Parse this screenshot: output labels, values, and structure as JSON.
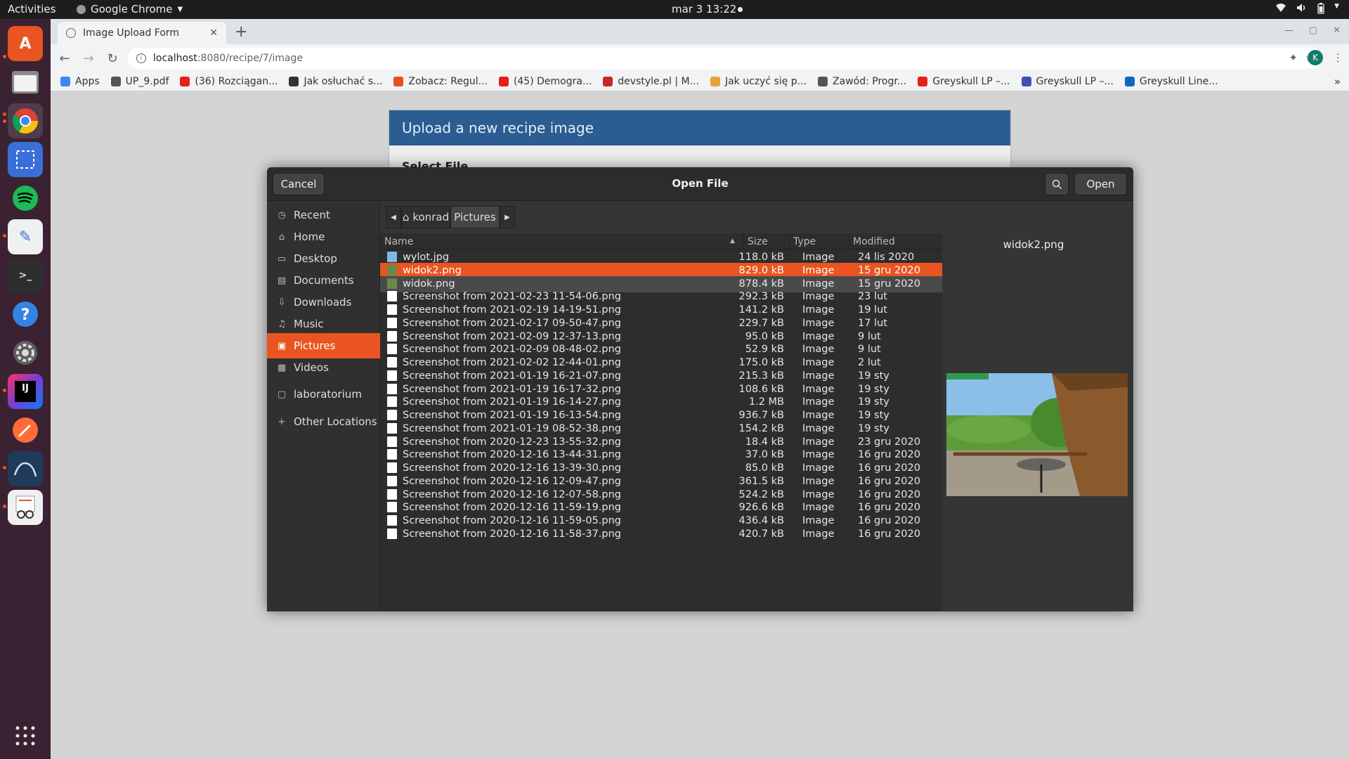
{
  "topbar": {
    "activities": "Activities",
    "app_name": "Google Chrome",
    "clock": "mar 3  13:22"
  },
  "browser": {
    "tab_title": "Image Upload Form",
    "url_host": "localhost",
    "url_path": ":8080/recipe/7/image",
    "profile_initial": "K",
    "bookmarks": [
      {
        "label": "Apps",
        "color": "#4285f4"
      },
      {
        "label": "UP_9.pdf",
        "color": "#555555"
      },
      {
        "label": "(36) Rozciągan...",
        "color": "#e62117"
      },
      {
        "label": "Jak osłuchać s...",
        "color": "#333333"
      },
      {
        "label": "Zobacz: Regul...",
        "color": "#e94e1b"
      },
      {
        "label": "(45) Demogra...",
        "color": "#e62117"
      },
      {
        "label": "devstyle.pl | M...",
        "color": "#c62828"
      },
      {
        "label": "Jak uczyć się p...",
        "color": "#e6a23c"
      },
      {
        "label": "Zawód: Progr...",
        "color": "#555555"
      },
      {
        "label": "Greyskull LP –...",
        "color": "#e62117"
      },
      {
        "label": "Greyskull LP –...",
        "color": "#3f51b5"
      },
      {
        "label": "Greyskull Line...",
        "color": "#1565c0"
      }
    ]
  },
  "page": {
    "form_title": "Upload a new recipe image",
    "form_subtitle": "Select File"
  },
  "dialog": {
    "title": "Open File",
    "cancel_label": "Cancel",
    "open_label": "Open",
    "places": [
      {
        "label": "Recent",
        "icon": "clock-icon",
        "glyph": "◷"
      },
      {
        "label": "Home",
        "icon": "home-icon",
        "glyph": "⌂"
      },
      {
        "label": "Desktop",
        "icon": "desktop-icon",
        "glyph": "▭"
      },
      {
        "label": "Documents",
        "icon": "document-icon",
        "glyph": "▤"
      },
      {
        "label": "Downloads",
        "icon": "download-icon",
        "glyph": "⇩"
      },
      {
        "label": "Music",
        "icon": "music-icon",
        "glyph": "♫"
      },
      {
        "label": "Pictures",
        "icon": "pictures-icon",
        "glyph": "▣",
        "selected": true
      },
      {
        "label": "Videos",
        "icon": "video-icon",
        "glyph": "▦"
      },
      {
        "label": "laboratorium",
        "icon": "folder-icon",
        "glyph": "▢"
      },
      {
        "label": "Other Locations",
        "icon": "plus-icon",
        "glyph": "+"
      }
    ],
    "path": {
      "home_label": "konrad",
      "current_label": "Pictures"
    },
    "columns": {
      "name": "Name",
      "size": "Size",
      "type": "Type",
      "modified": "Modified"
    },
    "files": [
      {
        "name": "wylot.jpg",
        "size": "118.0 kB",
        "type": "Image",
        "modified": "24 lis 2020"
      },
      {
        "name": "widok2.png",
        "size": "829.0 kB",
        "type": "Image",
        "modified": "15 gru 2020",
        "selected": true
      },
      {
        "name": "widok.png",
        "size": "878.4 kB",
        "type": "Image",
        "modified": "15 gru 2020",
        "hovered": true
      },
      {
        "name": "Screenshot from 2021-02-23 11-54-06.png",
        "size": "292.3 kB",
        "type": "Image",
        "modified": "23 lut"
      },
      {
        "name": "Screenshot from 2021-02-19 14-19-51.png",
        "size": "141.2 kB",
        "type": "Image",
        "modified": "19 lut"
      },
      {
        "name": "Screenshot from 2021-02-17 09-50-47.png",
        "size": "229.7 kB",
        "type": "Image",
        "modified": "17 lut"
      },
      {
        "name": "Screenshot from 2021-02-09 12-37-13.png",
        "size": "95.0 kB",
        "type": "Image",
        "modified": "9 lut"
      },
      {
        "name": "Screenshot from 2021-02-09 08-48-02.png",
        "size": "52.9 kB",
        "type": "Image",
        "modified": "9 lut"
      },
      {
        "name": "Screenshot from 2021-02-02 12-44-01.png",
        "size": "175.0 kB",
        "type": "Image",
        "modified": "2 lut"
      },
      {
        "name": "Screenshot from 2021-01-19 16-21-07.png",
        "size": "215.3 kB",
        "type": "Image",
        "modified": "19 sty"
      },
      {
        "name": "Screenshot from 2021-01-19 16-17-32.png",
        "size": "108.6 kB",
        "type": "Image",
        "modified": "19 sty"
      },
      {
        "name": "Screenshot from 2021-01-19 16-14-27.png",
        "size": "1.2 MB",
        "type": "Image",
        "modified": "19 sty"
      },
      {
        "name": "Screenshot from 2021-01-19 16-13-54.png",
        "size": "936.7 kB",
        "type": "Image",
        "modified": "19 sty"
      },
      {
        "name": "Screenshot from 2021-01-19 08-52-38.png",
        "size": "154.2 kB",
        "type": "Image",
        "modified": "19 sty"
      },
      {
        "name": "Screenshot from 2020-12-23 13-55-32.png",
        "size": "18.4 kB",
        "type": "Image",
        "modified": "23 gru 2020"
      },
      {
        "name": "Screenshot from 2020-12-16 13-44-31.png",
        "size": "37.0 kB",
        "type": "Image",
        "modified": "16 gru 2020"
      },
      {
        "name": "Screenshot from 2020-12-16 13-39-30.png",
        "size": "85.0 kB",
        "type": "Image",
        "modified": "16 gru 2020"
      },
      {
        "name": "Screenshot from 2020-12-16 12-09-47.png",
        "size": "361.5 kB",
        "type": "Image",
        "modified": "16 gru 2020"
      },
      {
        "name": "Screenshot from 2020-12-16 12-07-58.png",
        "size": "524.2 kB",
        "type": "Image",
        "modified": "16 gru 2020"
      },
      {
        "name": "Screenshot from 2020-12-16 11-59-19.png",
        "size": "926.6 kB",
        "type": "Image",
        "modified": "16 gru 2020"
      },
      {
        "name": "Screenshot from 2020-12-16 11-59-05.png",
        "size": "436.4 kB",
        "type": "Image",
        "modified": "16 gru 2020"
      },
      {
        "name": "Screenshot from 2020-12-16 11-58-37.png",
        "size": "420.7 kB",
        "type": "Image",
        "modified": "16 gru 2020"
      }
    ],
    "preview": {
      "file_name": "widok2.png"
    }
  },
  "colors": {
    "accent": "#e95420",
    "form_header": "#2b5d92",
    "dock": "#3a2232"
  }
}
